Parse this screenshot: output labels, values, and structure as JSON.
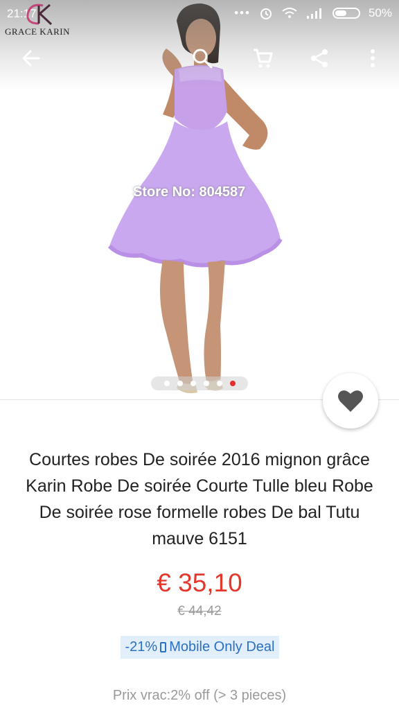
{
  "status_bar": {
    "time": "21:17",
    "battery": "50%"
  },
  "brand": {
    "name": "GRACE KARIN",
    "monogram": "GK"
  },
  "toolbar": {
    "icons": [
      "back-arrow-icon",
      "search-icon",
      "cart-icon",
      "share-icon",
      "more-vert-icon"
    ]
  },
  "gallery": {
    "watermark": "Store No: 804587",
    "image_count": 6,
    "active_index": 5
  },
  "product": {
    "title": "Courtes robes De soirée 2016 mignon grâce Karin Robe De soirée Courte Tulle bleu Robe De soirée rose formelle robes De bal Tutu mauve 6151",
    "price": "€ 35,10",
    "original_price": "€ 44,42",
    "deal_discount": "-21%",
    "deal_label": "Mobile Only Deal",
    "bulk_price": "Prix vrac:2% off (> 3 pieces)"
  },
  "colors": {
    "price": "#e3372c",
    "deal_text": "#2a70c2",
    "deal_bg": "#e2eefa",
    "dress": "#c9a6ef"
  }
}
